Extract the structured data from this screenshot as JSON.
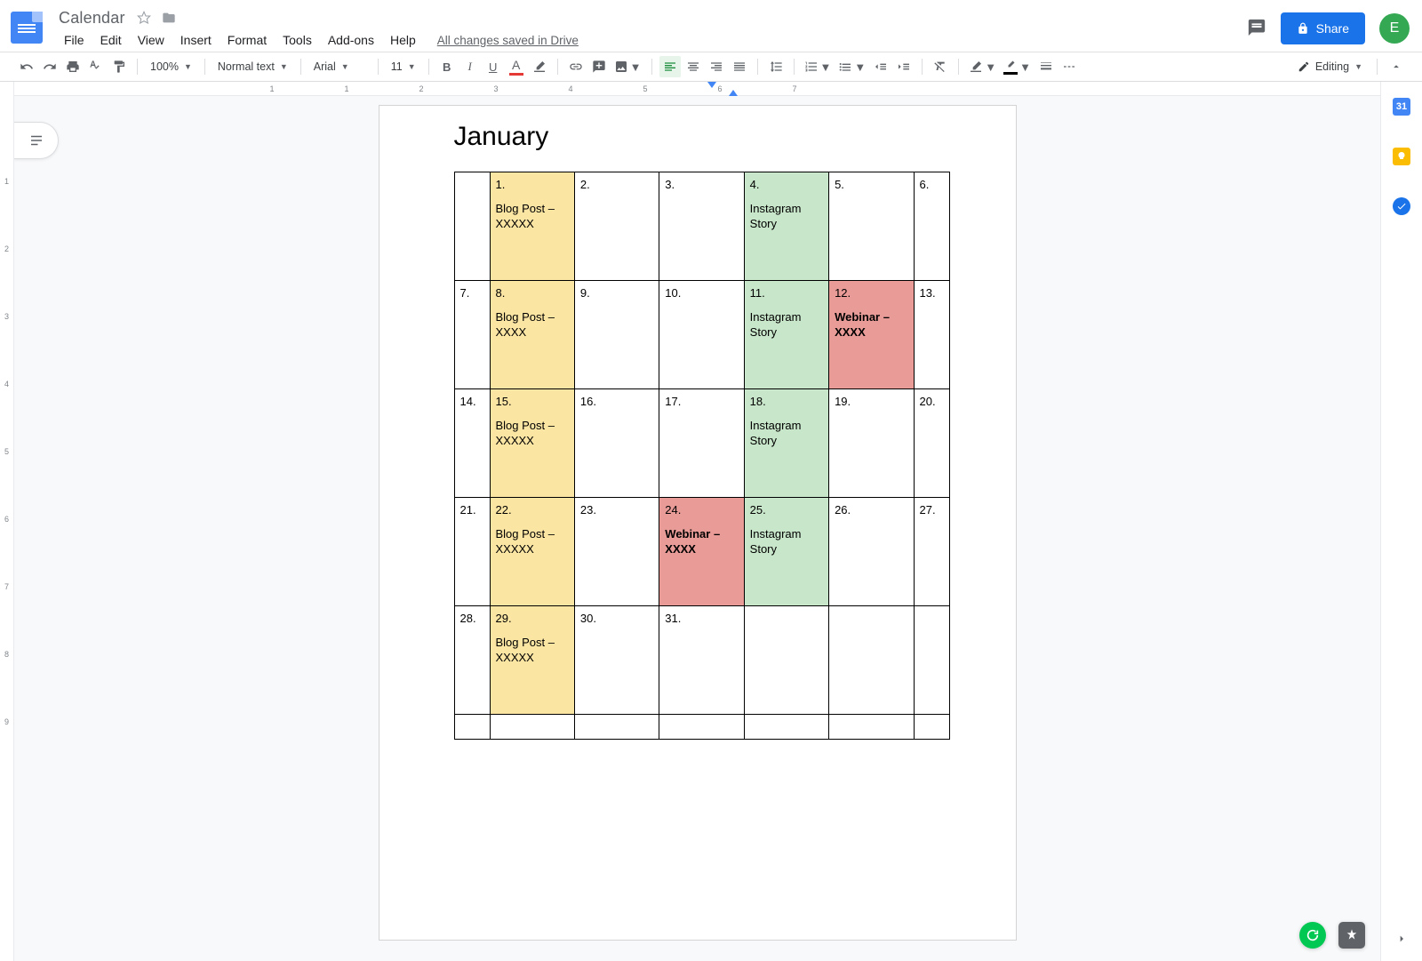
{
  "header": {
    "doc_title": "Calendar",
    "saved_status": "All changes saved in Drive",
    "share_label": "Share",
    "avatar_initial": "E"
  },
  "menus": [
    "File",
    "Edit",
    "View",
    "Insert",
    "Format",
    "Tools",
    "Add-ons",
    "Help"
  ],
  "toolbar": {
    "zoom": "100%",
    "style": "Normal text",
    "font": "Arial",
    "font_size": "11",
    "mode": "Editing"
  },
  "ruler_h": [
    "1",
    "1",
    "2",
    "3",
    "4",
    "5",
    "6",
    "7"
  ],
  "ruler_v": [
    "1",
    "2",
    "3",
    "4",
    "5",
    "6",
    "7",
    "8",
    "9"
  ],
  "document": {
    "title": "January",
    "rows": [
      [
        {
          "num": "",
          "event": "",
          "bg": ""
        },
        {
          "num": "1.",
          "event": "Blog Post  – XXXXX",
          "bg": "yellow"
        },
        {
          "num": "2.",
          "event": "",
          "bg": ""
        },
        {
          "num": "3.",
          "event": "",
          "bg": ""
        },
        {
          "num": "4.",
          "event": "Instagram Story",
          "bg": "green"
        },
        {
          "num": "5.",
          "event": "",
          "bg": ""
        },
        {
          "num": "6.",
          "event": "",
          "bg": ""
        }
      ],
      [
        {
          "num": "7.",
          "event": "",
          "bg": ""
        },
        {
          "num": "8.",
          "event": "Blog Post – XXXX",
          "bg": "yellow"
        },
        {
          "num": "9.",
          "event": "",
          "bg": ""
        },
        {
          "num": "10.",
          "event": "",
          "bg": ""
        },
        {
          "num": "11.",
          "event": "Instagram Story",
          "bg": "green"
        },
        {
          "num": "12.",
          "event": "Webinar – XXXX",
          "bg": "red",
          "bold": true
        },
        {
          "num": "13.",
          "event": "",
          "bg": ""
        }
      ],
      [
        {
          "num": "14.",
          "event": "",
          "bg": ""
        },
        {
          "num": "15.",
          "event": "Blog Post  – XXXXX",
          "bg": "yellow"
        },
        {
          "num": "16.",
          "event": "",
          "bg": ""
        },
        {
          "num": "17.",
          "event": "",
          "bg": ""
        },
        {
          "num": "18.",
          "event": "Instagram Story",
          "bg": "green"
        },
        {
          "num": "19.",
          "event": "",
          "bg": ""
        },
        {
          "num": "20.",
          "event": "",
          "bg": ""
        }
      ],
      [
        {
          "num": "21.",
          "event": "",
          "bg": ""
        },
        {
          "num": "22.",
          "event": "Blog Post  – XXXXX",
          "bg": "yellow"
        },
        {
          "num": "23.",
          "event": "",
          "bg": ""
        },
        {
          "num": "24.",
          "event": "Webinar – XXXX",
          "bg": "red",
          "bold": true
        },
        {
          "num": "25.",
          "event": "Instagram Story",
          "bg": "green"
        },
        {
          "num": "26.",
          "event": "",
          "bg": ""
        },
        {
          "num": "27.",
          "event": "",
          "bg": ""
        }
      ],
      [
        {
          "num": "28.",
          "event": "",
          "bg": ""
        },
        {
          "num": "29.",
          "event": "Blog Post  – XXXXX",
          "bg": "yellow"
        },
        {
          "num": "30.",
          "event": "",
          "bg": ""
        },
        {
          "num": "31.",
          "event": "",
          "bg": ""
        },
        {
          "num": "",
          "event": "",
          "bg": ""
        },
        {
          "num": "",
          "event": "",
          "bg": ""
        },
        {
          "num": "",
          "event": "",
          "bg": ""
        }
      ],
      [
        {
          "num": "",
          "event": "",
          "bg": ""
        },
        {
          "num": "",
          "event": "",
          "bg": ""
        },
        {
          "num": "",
          "event": "",
          "bg": ""
        },
        {
          "num": "",
          "event": "",
          "bg": ""
        },
        {
          "num": "",
          "event": "",
          "bg": ""
        },
        {
          "num": "",
          "event": "",
          "bg": ""
        },
        {
          "num": "",
          "event": "",
          "bg": ""
        }
      ]
    ]
  },
  "side_panel": {
    "calendar_day": "31"
  }
}
